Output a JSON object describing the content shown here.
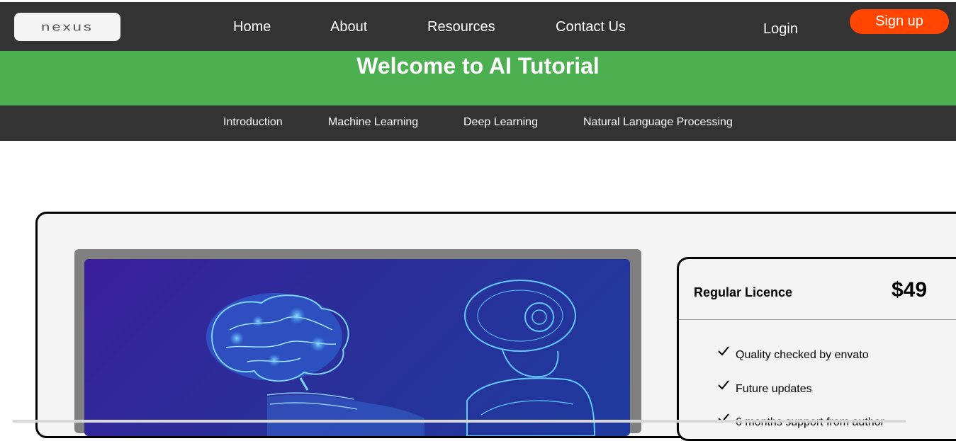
{
  "header": {
    "logo_text": "nexus",
    "nav": [
      "Home",
      "About",
      "Resources",
      "Contact Us"
    ],
    "login_label": "Login",
    "signup_label": "Sign up",
    "colors": {
      "bar": "#333333",
      "signup": "#ff4500"
    }
  },
  "hero": {
    "title": "Welcome to AI Tutorial",
    "color": "#4caf50"
  },
  "subnav": {
    "items": [
      "Introduction",
      "Machine Learning",
      "Deep Learning",
      "Natural Language Processing"
    ]
  },
  "pricing": {
    "name": "Regular Licence",
    "price": "$49",
    "features": [
      "Quality checked by envato",
      "Future updates",
      "6 months support from author"
    ]
  },
  "icons": {
    "check": "check-icon",
    "brain": "brain-illustration",
    "robot": "robot-illustration"
  }
}
